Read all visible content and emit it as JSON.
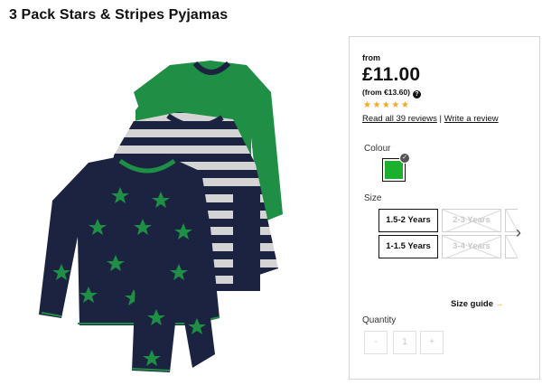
{
  "product": {
    "title": "3 Pack Stars & Stripes Pyjamas"
  },
  "price": {
    "from_label": "from",
    "main": "£11.00",
    "alt": "(from €13.60)",
    "info_icon": "?"
  },
  "rating": {
    "stars": "★★★★★",
    "value": 5,
    "read_reviews": "Read all 39 reviews",
    "separator": "|",
    "write_review": "Write a review"
  },
  "colour": {
    "label": "Colour",
    "selected_hex": "#1db02e",
    "check_icon": "✓"
  },
  "size": {
    "label": "Size",
    "options": [
      {
        "label": "1.5-2 Years",
        "available": true
      },
      {
        "label": "2-3 Years",
        "available": false
      },
      {
        "label": "1-1.5 Years",
        "available": true
      },
      {
        "label": "3-4 Years",
        "available": false
      }
    ],
    "next_icon": "›",
    "guide_label": "Size guide",
    "guide_arrow": "→"
  },
  "quantity": {
    "label": "Quantity",
    "minus": "-",
    "value": "1",
    "plus": "+"
  },
  "colors": {
    "accent": "#f5a623",
    "navy": "#1b2340",
    "green": "#1f8f45",
    "stripe_light": "#cfcfcf"
  }
}
